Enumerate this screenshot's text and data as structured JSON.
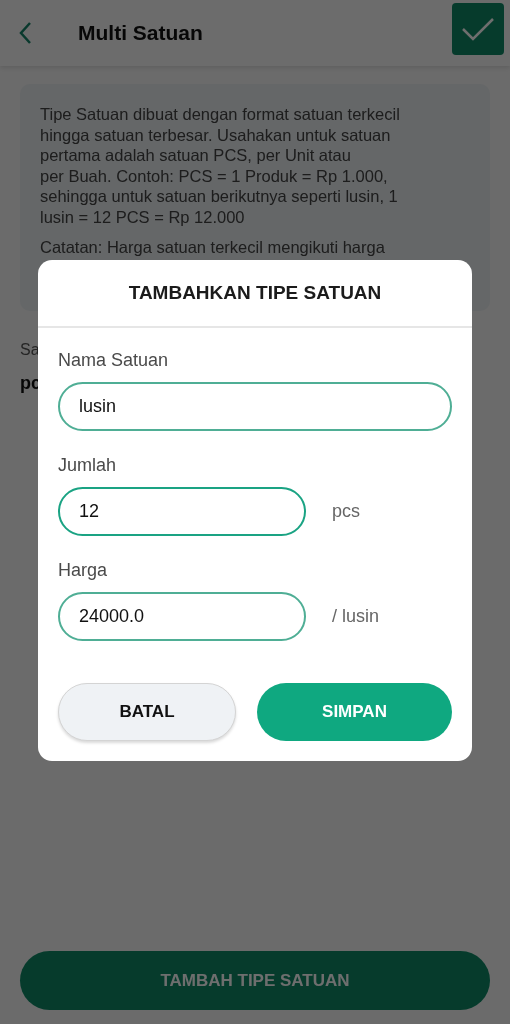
{
  "header": {
    "title": "Multi Satuan"
  },
  "info_card": {
    "text": "Tipe Satuan dibuat dengan format satuan terkecil\nhingga satuan terbesar. Usahakan untuk satuan\npertama adalah satuan PCS, per Unit atau\nper Buah. Contoh: PCS = 1 Produk = Rp 1.000,\nsehingga untuk satuan berikutnya seperti lusin, 1\nlusin = 12 PCS = Rp 12.000",
    "note": "Catatan: Harga satuan terkecil mengikuti harga"
  },
  "base_unit": {
    "label": "Sa",
    "value": "pc"
  },
  "add_button": "TAMBAH TIPE SATUAN",
  "dialog": {
    "title": "TAMBAHKAN TIPE SATUAN",
    "fields": [
      {
        "label": "Nama Satuan",
        "value": "lusin",
        "kind": "wide"
      },
      {
        "label": "Jumlah",
        "value": "12",
        "suffix": "pcs",
        "kind": "short",
        "focused": true
      },
      {
        "label": "Harga",
        "value": "24000.0",
        "suffix": "/ lusin",
        "kind": "short",
        "focused": false
      }
    ],
    "buttons": [
      {
        "label": "BATAL",
        "kind": "secondary"
      },
      {
        "label": "SIMPAN",
        "kind": "primary"
      }
    ]
  }
}
